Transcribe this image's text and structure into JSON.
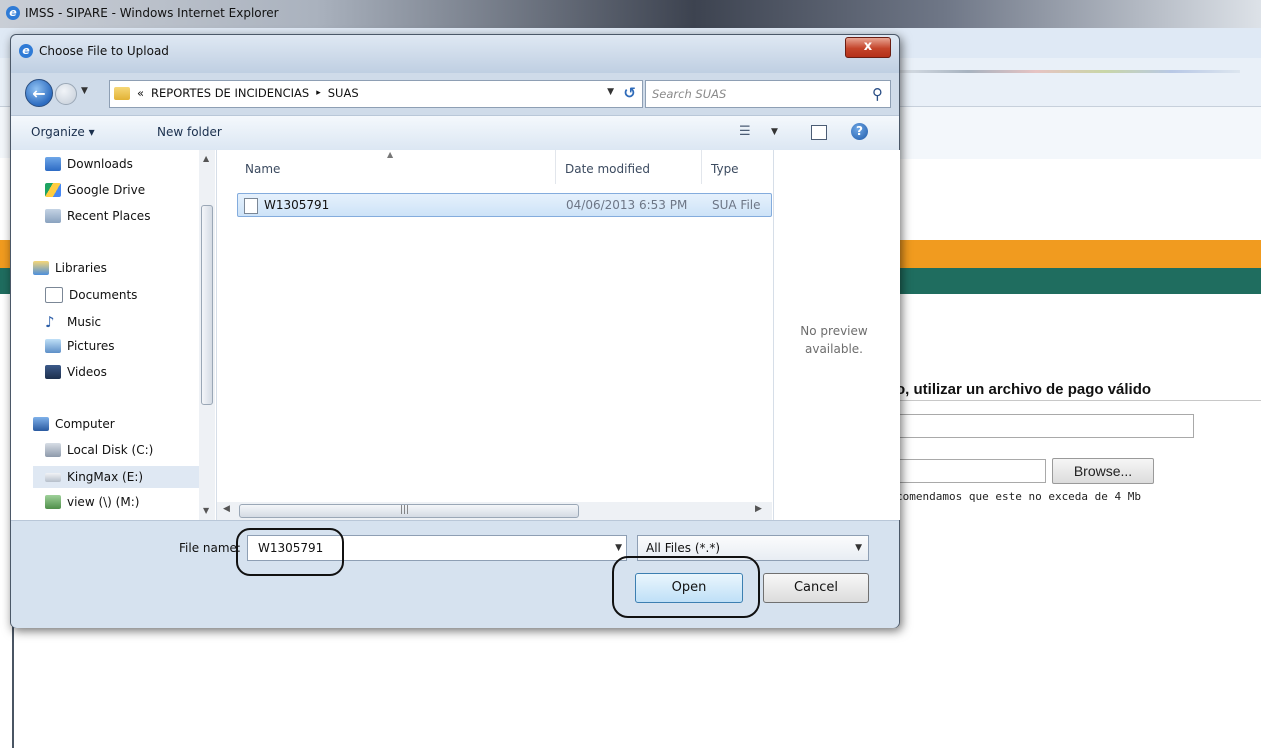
{
  "browser": {
    "title": "IMSS - SIPARE - Windows Internet Explorer"
  },
  "page": {
    "heading_fragment": "o, utilizar un archivo de pago válido",
    "browse_label": "Browse...",
    "note_fragment": "comendamos que este no exceda de 4 Mb",
    "colors": {
      "orange_band": "#f19b1f",
      "green_band": "#1f6d5f"
    }
  },
  "dialog": {
    "title": "Choose File to Upload",
    "close_glyph": "x",
    "address": {
      "chevrons": "«",
      "segments": [
        "REPORTES DE INCIDENCIAS",
        "SUAS"
      ],
      "separator": "▸"
    },
    "search_placeholder": "Search SUAS",
    "toolbar": {
      "organize_label": "Organize ▾",
      "new_folder_label": "New folder"
    },
    "nav_items": [
      {
        "label": "Downloads",
        "icon": "downloads-folder-icon"
      },
      {
        "label": "Google Drive",
        "icon": "google-drive-icon"
      },
      {
        "label": "Recent Places",
        "icon": "recent-places-icon"
      },
      {
        "label": "Libraries",
        "icon": "libraries-icon"
      },
      {
        "label": "Documents",
        "icon": "documents-icon"
      },
      {
        "label": "Music",
        "icon": "music-icon"
      },
      {
        "label": "Pictures",
        "icon": "pictures-icon"
      },
      {
        "label": "Videos",
        "icon": "videos-icon"
      },
      {
        "label": "Computer",
        "icon": "computer-icon"
      },
      {
        "label": "Local Disk (C:)",
        "icon": "local-disk-icon"
      },
      {
        "label": "KingMax (E:)",
        "icon": "removable-drive-icon",
        "selected": true
      },
      {
        "label": "view (\\) (M:)",
        "icon": "network-drive-icon"
      }
    ],
    "columns": {
      "name": "Name",
      "date_modified": "Date modified",
      "type": "Type"
    },
    "files": [
      {
        "name": "W1305791",
        "date_modified": "04/06/2013 6:53 PM",
        "type": "SUA File"
      }
    ],
    "preview_text": "No preview available.",
    "file_name_label": "File name:",
    "file_name_value": "W1305791",
    "file_type_value": "All Files (*.*)",
    "open_label": "Open",
    "cancel_label": "Cancel"
  }
}
